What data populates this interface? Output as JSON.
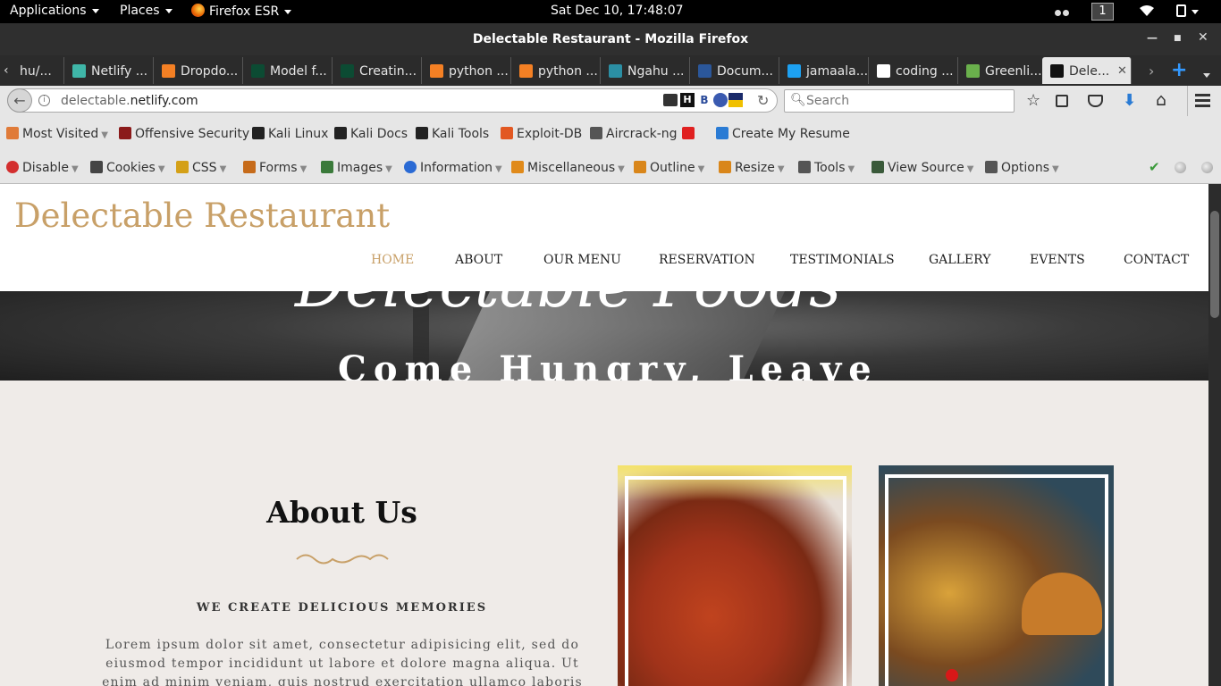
{
  "system": {
    "applications": "Applications",
    "places": "Places",
    "browser_menu": "Firefox ESR",
    "clock": "Sat Dec 10, 17:48:07",
    "workspace": "1"
  },
  "window": {
    "title": "Delectable Restaurant - Mozilla Firefox"
  },
  "tabs": [
    {
      "label": "hu/...",
      "icon": "page-icon",
      "color": "#555555"
    },
    {
      "label": "Netlify ...",
      "icon": "netlify-icon",
      "color": "#3fb6a8"
    },
    {
      "label": "Dropdo...",
      "icon": "stackoverflow-icon",
      "color": "#f48024"
    },
    {
      "label": "Model f...",
      "icon": "django-icon",
      "color": "#0c4b33"
    },
    {
      "label": "Creatin...",
      "icon": "django-icon",
      "color": "#0c4b33"
    },
    {
      "label": "python ...",
      "icon": "stackoverflow-icon",
      "color": "#f48024"
    },
    {
      "label": "python ...",
      "icon": "stackoverflow-icon",
      "color": "#f48024"
    },
    {
      "label": "Ngahu ...",
      "icon": "r-icon",
      "color": "#2b8fa4"
    },
    {
      "label": "Docum...",
      "icon": "word-icon",
      "color": "#2b579a"
    },
    {
      "label": "jamaala...",
      "icon": "y-icon",
      "color": "#1da1f2"
    },
    {
      "label": "coding ...",
      "icon": "google-icon",
      "color": "#ffffff"
    },
    {
      "label": "Greenli...",
      "icon": "leaf-icon",
      "color": "#6ab04c"
    },
    {
      "label": "Dele...",
      "icon": "d-icon",
      "color": "#111111"
    }
  ],
  "nav": {
    "url_host": "delectable.",
    "url_domain": "netlify.com",
    "search_placeholder": "Search"
  },
  "bookmarks": [
    {
      "label": "Most Visited",
      "icon": "folder-icon",
      "color": "#e07b39",
      "dropdown": true
    },
    {
      "label": "Offensive Security",
      "icon": "offsec-icon",
      "color": "#8b1a1a"
    },
    {
      "label": "Kali Linux",
      "icon": "kali-icon",
      "color": "#222222"
    },
    {
      "label": "Kali Docs",
      "icon": "kali-icon",
      "color": "#222222"
    },
    {
      "label": "Kali Tools",
      "icon": "kali-icon",
      "color": "#222222"
    },
    {
      "label": "Exploit-DB",
      "icon": "exploitdb-icon",
      "color": "#e25822"
    },
    {
      "label": "Aircrack-ng",
      "icon": "aircrack-icon",
      "color": "#555555"
    },
    {
      "label": "",
      "icon": "help-icon",
      "color": "#e02020"
    },
    {
      "label": "Create My Resume",
      "icon": "p-icon",
      "color": "#2a7bd4"
    }
  ],
  "webdev": [
    {
      "label": "Disable",
      "icon": "disable-icon",
      "color": "#d32f2f"
    },
    {
      "label": "Cookies",
      "icon": "cookie-icon",
      "color": "#444444"
    },
    {
      "label": "CSS",
      "icon": "css-icon",
      "color": "#d4a017"
    },
    {
      "label": "Forms",
      "icon": "forms-icon",
      "color": "#c66b1a"
    },
    {
      "label": "Images",
      "icon": "images-icon",
      "color": "#3a7a3a"
    },
    {
      "label": "Information",
      "icon": "info-icon",
      "color": "#2a6ad4"
    },
    {
      "label": "Miscellaneous",
      "icon": "misc-icon",
      "color": "#e08a1a"
    },
    {
      "label": "Outline",
      "icon": "outline-icon",
      "color": "#d9861a"
    },
    {
      "label": "Resize",
      "icon": "resize-icon",
      "color": "#d9861a"
    },
    {
      "label": "Tools",
      "icon": "tools-icon",
      "color": "#555555"
    },
    {
      "label": "View Source",
      "icon": "source-icon",
      "color": "#3a5a3a"
    },
    {
      "label": "Options",
      "icon": "options-icon",
      "color": "#555555"
    }
  ],
  "site": {
    "brand": "Delectable Restaurant",
    "menu": [
      "HOME",
      "ABOUT",
      "OUR MENU",
      "RESERVATION",
      "TESTIMONIALS",
      "GALLERY",
      "EVENTS",
      "CONTACT"
    ],
    "active_menu": "HOME",
    "hero_script": "Delectable Foods",
    "hero_tagline": "Come Hungry, Leave",
    "about_title": "About Us",
    "about_subtitle": "WE CREATE DELICIOUS MEMORIES",
    "about_text": "Lorem ipsum dolor sit amet, consectetur adipisicing elit, sed do eiusmod tempor incididunt ut labore et dolore magna aliqua. Ut enim ad minim veniam, quis nostrud exercitation ullamco laboris",
    "accent_color": "#c8a068"
  }
}
